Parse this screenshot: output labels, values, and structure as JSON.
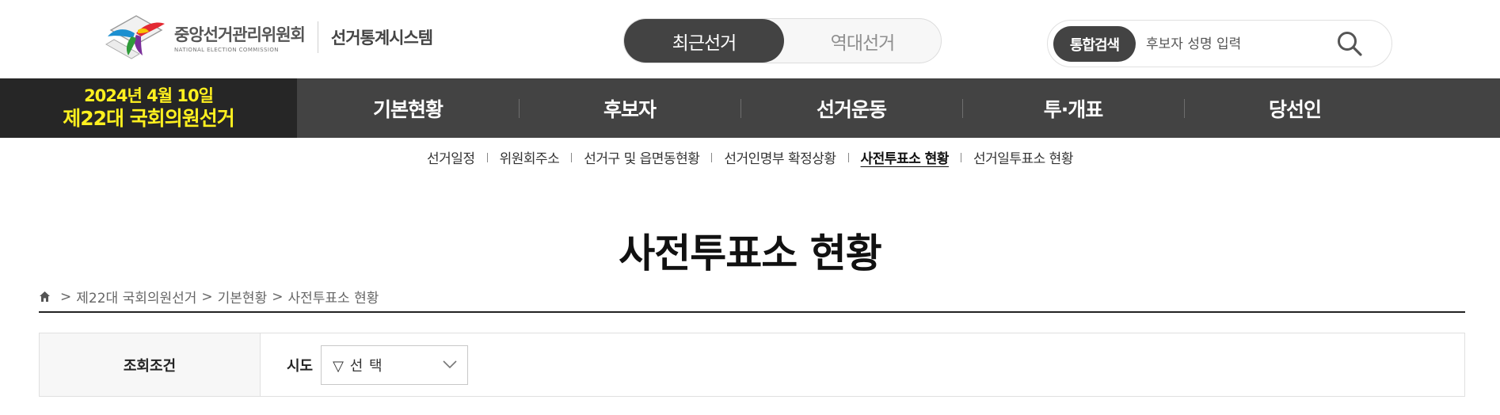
{
  "header": {
    "org_name": "중앙선거관리위원회",
    "org_name_en": "NATIONAL ELECTION COMMISSION",
    "system_name": "선거통계시스템",
    "toggle": {
      "recent": "최근선거",
      "past": "역대선거"
    },
    "search": {
      "button_label": "통합검색",
      "placeholder": "후보자 성명 입력"
    }
  },
  "election": {
    "date": "2024년 4월 10일",
    "title": "제22대 국회의원선거"
  },
  "gnb": [
    "기본현황",
    "후보자",
    "선거운동",
    "투·개표",
    "당선인"
  ],
  "subnav": [
    "선거일정",
    "위원회주소",
    "선거구 및 읍면동현황",
    "선거인명부 확정상황",
    "사전투표소 현황",
    "선거일투표소 현황"
  ],
  "subnav_active_index": 4,
  "page_title": "사전투표소 현황",
  "breadcrumb": [
    ">",
    "제22대 국회의원선거",
    ">",
    "기본현황",
    ">",
    "사전투표소 현황"
  ],
  "query": {
    "label": "조회조건",
    "sido_label": "시도",
    "sido_value": "▽ 선 택"
  },
  "colors": {
    "accent_dark": "#434343",
    "badge_bg": "#262626",
    "badge_text": "#fff01f"
  }
}
